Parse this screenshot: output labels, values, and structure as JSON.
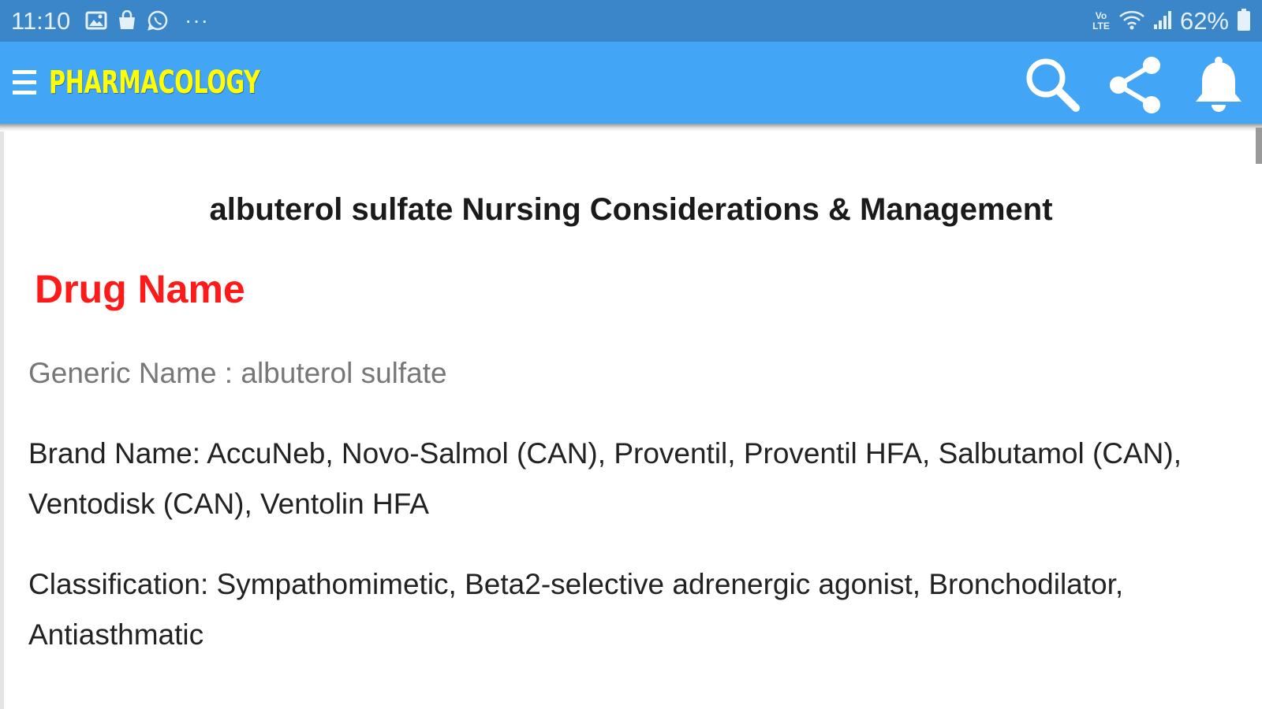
{
  "status_bar": {
    "time": "11:10",
    "more": "···",
    "volte": "Vo LTE",
    "battery_percent": "62%",
    "left_icons": [
      "gallery-icon",
      "bag-icon",
      "whatsapp-icon"
    ],
    "right_icons": [
      "wifi-icon",
      "signal-icon",
      "battery-icon"
    ]
  },
  "app_bar": {
    "title": "PHARMACOLOGY",
    "title_color": "#ffff00",
    "background": "#42a5f5",
    "actions": [
      "search-icon",
      "share-icon",
      "bell-icon"
    ]
  },
  "content": {
    "title": "albuterol sulfate Nursing Considerations & Management",
    "section_heading": "Drug Name",
    "section_heading_color": "#ff1a1a",
    "generic_name": "Generic Name : albuterol sulfate",
    "brand_name": "Brand Name:  AccuNeb, Novo-Salmol (CAN), Proventil, Proventil HFA, Salbutamol (CAN), Ventodisk (CAN), Ventolin HFA",
    "classification": "Classification: Sympathomimetic, Beta2-selective adrenergic agonist, Bronchodilator, Antiasthmatic"
  }
}
